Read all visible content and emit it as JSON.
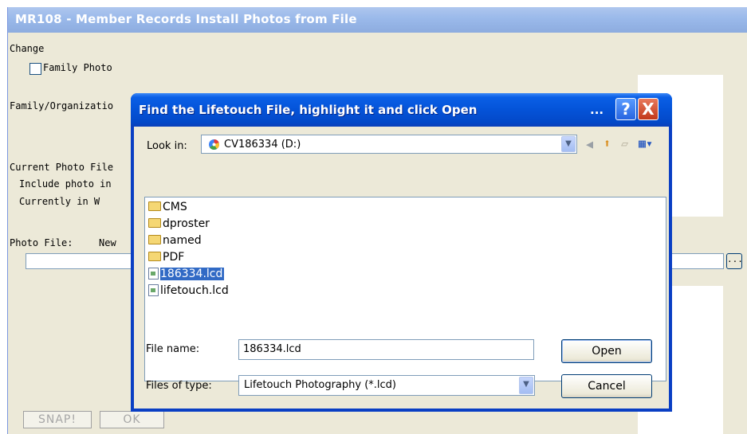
{
  "window": {
    "title": "MR108 - Member Records Install Photos from File",
    "change_label": "Change",
    "family_photo_label": "Family Photo",
    "family_org_label": "Family/Organizatio",
    "current_photo_label": "Current Photo File",
    "include_photo_label": "Include photo in",
    "currently_in_label": "Currently in W",
    "photo_file_label": "Photo File:",
    "photo_file_new_label": "New",
    "browse_label": "...",
    "snap_label": "SNAP!",
    "ok_label": "OK"
  },
  "dialog": {
    "title": "Find the Lifetouch File, highlight it and click Open",
    "ellipsis": "...",
    "help_label": "?",
    "close_label": "X",
    "look_in_label": "Look in:",
    "look_in_value": "CV186334 (D:)",
    "file_list": [
      {
        "name": "CMS",
        "type": "folder",
        "selected": false
      },
      {
        "name": "dproster",
        "type": "folder",
        "selected": false
      },
      {
        "name": "named",
        "type": "folder",
        "selected": false
      },
      {
        "name": "PDF",
        "type": "folder",
        "selected": false
      },
      {
        "name": "186334.lcd",
        "type": "file",
        "selected": true
      },
      {
        "name": "lifetouch.lcd",
        "type": "file",
        "selected": false
      }
    ],
    "file_name_label": "File name:",
    "file_name_value": "186334.lcd",
    "files_of_type_label": "Files of type:",
    "files_of_type_value": "Lifetouch Photography (*.lcd)",
    "open_label": "Open",
    "cancel_label": "Cancel"
  },
  "colors": {
    "dialog_titlebar": "#0453d8",
    "selection": "#316ac5",
    "window_face": "#ece9d8"
  }
}
